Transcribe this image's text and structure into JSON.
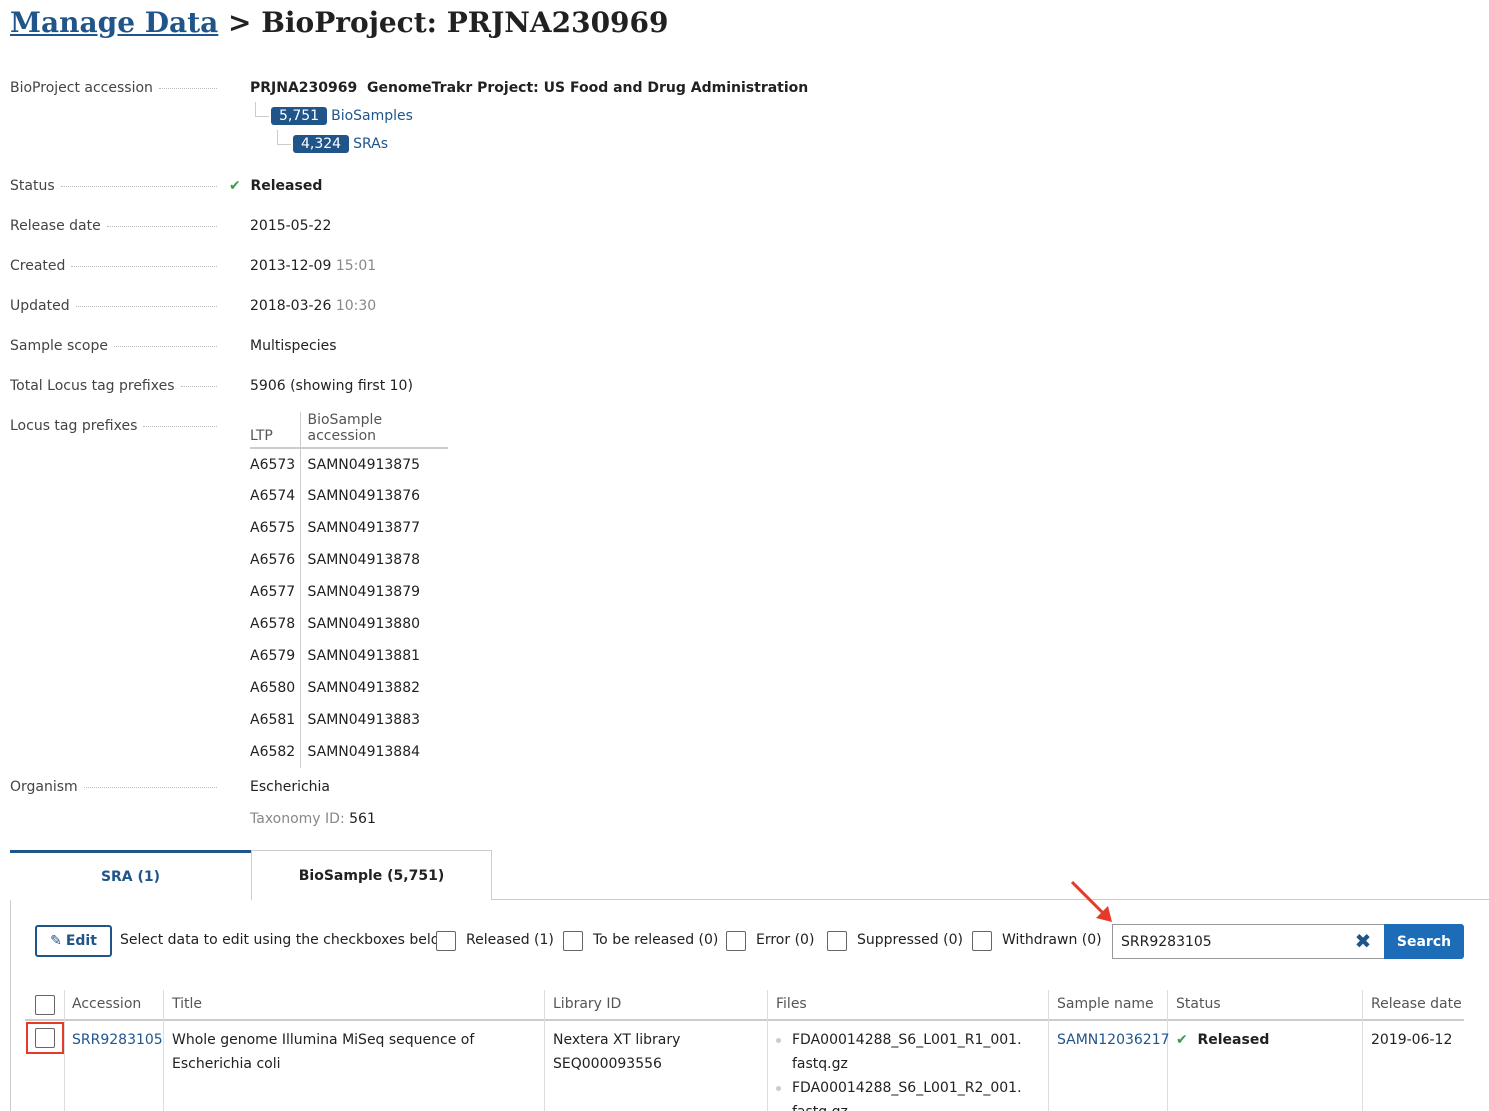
{
  "header": {
    "breadcrumb_link": "Manage Data",
    "separator": ">",
    "title": "BioProject: PRJNA230969"
  },
  "details": {
    "accession_label": "BioProject accession",
    "accession_id": "PRJNA230969",
    "accession_title": "GenomeTrakr Project: US Food and Drug Administration",
    "biosamples_count": "5,751",
    "biosamples_label": "BioSamples",
    "sras_count": "4,324",
    "sras_label": "SRAs",
    "status_label": "Status",
    "status_value": "Released",
    "release_date_label": "Release date",
    "release_date_value": "2015-05-22",
    "created_label": "Created",
    "created_date": "2013-12-09",
    "created_time": "15:01",
    "updated_label": "Updated",
    "updated_date": "2018-03-26",
    "updated_time": "10:30",
    "sample_scope_label": "Sample scope",
    "sample_scope_value": "Multispecies",
    "total_ltp_label": "Total Locus tag prefixes",
    "total_ltp_value": "5906 (showing first 10)",
    "ltp_label": "Locus tag prefixes",
    "organism_label": "Organism",
    "organism_value": "Escherichia",
    "taxonomy_label": "Taxonomy ID:",
    "taxonomy_value": "561"
  },
  "ltp_table": {
    "headers": [
      "LTP",
      "BioSample accession"
    ],
    "rows": [
      [
        "A6573",
        "SAMN04913875"
      ],
      [
        "A6574",
        "SAMN04913876"
      ],
      [
        "A6575",
        "SAMN04913877"
      ],
      [
        "A6576",
        "SAMN04913878"
      ],
      [
        "A6577",
        "SAMN04913879"
      ],
      [
        "A6578",
        "SAMN04913880"
      ],
      [
        "A6579",
        "SAMN04913881"
      ],
      [
        "A6580",
        "SAMN04913882"
      ],
      [
        "A6581",
        "SAMN04913883"
      ],
      [
        "A6582",
        "SAMN04913884"
      ]
    ]
  },
  "tabs": [
    {
      "label": "SRA (1)",
      "active": true
    },
    {
      "label": "BioSample (5,751)",
      "active": false
    }
  ],
  "toolbar": {
    "edit_label": "Edit",
    "instruction": "Select data to edit using the checkboxes below",
    "filters": [
      "Released (1)",
      "To be released (0)",
      "Error (0)",
      "Suppressed (0)",
      "Withdrawn (0)"
    ],
    "search_value": "SRR9283105",
    "search_button": "Search"
  },
  "results": {
    "columns": [
      "Accession",
      "Title",
      "Library ID",
      "Files",
      "Sample name",
      "Status",
      "Release date"
    ],
    "row": {
      "accession": "SRR9283105",
      "title_line1": "Whole genome Illumina MiSeq sequence of",
      "title_line2": "Escherichia coli",
      "library_line1": "Nextera XT library",
      "library_line2": "SEQ000093556",
      "file1_line1": "FDA00014288_S6_L001_R1_001.",
      "file1_line2": "fastq.gz",
      "file2_line1": "FDA00014288_S6_L001_R2_001.",
      "file2_line2": "fastq.gz",
      "sample_name": "SAMN12036217",
      "status": "Released",
      "release_date": "2019-06-12"
    }
  },
  "colors": {
    "link": "#20558a",
    "accent_button": "#1c6cb8",
    "success": "#3b9a4b",
    "highlight": "#e53929"
  }
}
